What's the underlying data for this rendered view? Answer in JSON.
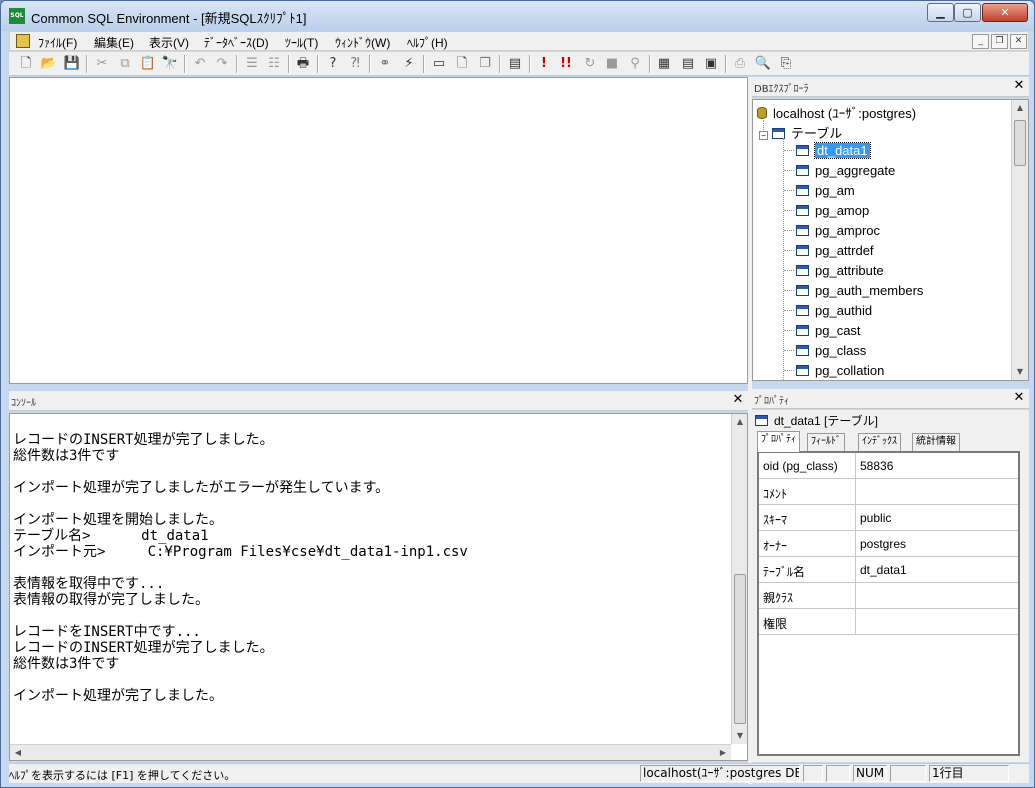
{
  "window": {
    "title": "Common SQL Environment - [新規SQLｽｸﾘﾌﾟﾄ1]",
    "app_icon_text": "SQL"
  },
  "menu": [
    {
      "label": "ﾌｧｲﾙ(F)"
    },
    {
      "label": "編集(E)"
    },
    {
      "label": "表示(V)"
    },
    {
      "label": "ﾃﾞｰﾀﾍﾞｰｽ(D)"
    },
    {
      "label": "ﾂｰﾙ(T)"
    },
    {
      "label": "ｳｨﾝﾄﾞｳ(W)"
    },
    {
      "label": "ﾍﾙﾌﾟ(H)"
    }
  ],
  "console": {
    "title": "ｺﾝｿｰﾙ",
    "lines": [
      "レコードのINSERT処理が完了しました。",
      "総件数は3件です",
      "",
      "インポート処理が完了しましたがエラーが発生しています。",
      "",
      "インポート処理を開始しました。",
      "テーブル名>      dt_data1",
      "インポート元>     C:¥Program Files¥cse¥dt_data1-inp1.csv",
      "",
      "表情報を取得中です...",
      "表情報の取得が完了しました。",
      "",
      "レコードをINSERT中です...",
      "レコードのINSERT処理が完了しました。",
      "総件数は3件です",
      "",
      "インポート処理が完了しました。"
    ]
  },
  "db_explorer": {
    "title": "DBｴｸｽﾌﾟﾛｰﾗ",
    "connection": "localhost (ﾕｰｻﾞ:postgres)",
    "folder": "テーブル",
    "tables": [
      "dt_data1",
      "pg_aggregate",
      "pg_am",
      "pg_amop",
      "pg_amproc",
      "pg_attrdef",
      "pg_attribute",
      "pg_auth_members",
      "pg_authid",
      "pg_cast",
      "pg_class",
      "pg_collation"
    ],
    "selected": "dt_data1"
  },
  "properties": {
    "title": "ﾌﾟﾛﾊﾟﾃｨ",
    "caption": "dt_data1 [テーブル]",
    "tabs": [
      "ﾌﾟﾛﾊﾟﾃｨ",
      "ﾌｨｰﾙﾄﾞ",
      "ｲﾝﾃﾞｯｸｽ",
      "統計情報"
    ],
    "rows": [
      {
        "key": "oid (pg_class)",
        "value": "58836"
      },
      {
        "key": "ｺﾒﾝﾄ",
        "value": ""
      },
      {
        "key": "ｽｷｰﾏ",
        "value": "public"
      },
      {
        "key": "ｵｰﾅｰ",
        "value": "postgres"
      },
      {
        "key": "ﾃｰﾌﾞﾙ名",
        "value": "dt_data1"
      },
      {
        "key": "親ｸﾗｽ",
        "value": ""
      },
      {
        "key": "権限",
        "value": ""
      }
    ]
  },
  "status": {
    "help": "ﾍﾙﾌﾟを表示するには [F1] を押してください。",
    "connection": "localhost(ﾕｰｻﾞ:postgres DB",
    "num": "NUM",
    "line": "1行目"
  }
}
